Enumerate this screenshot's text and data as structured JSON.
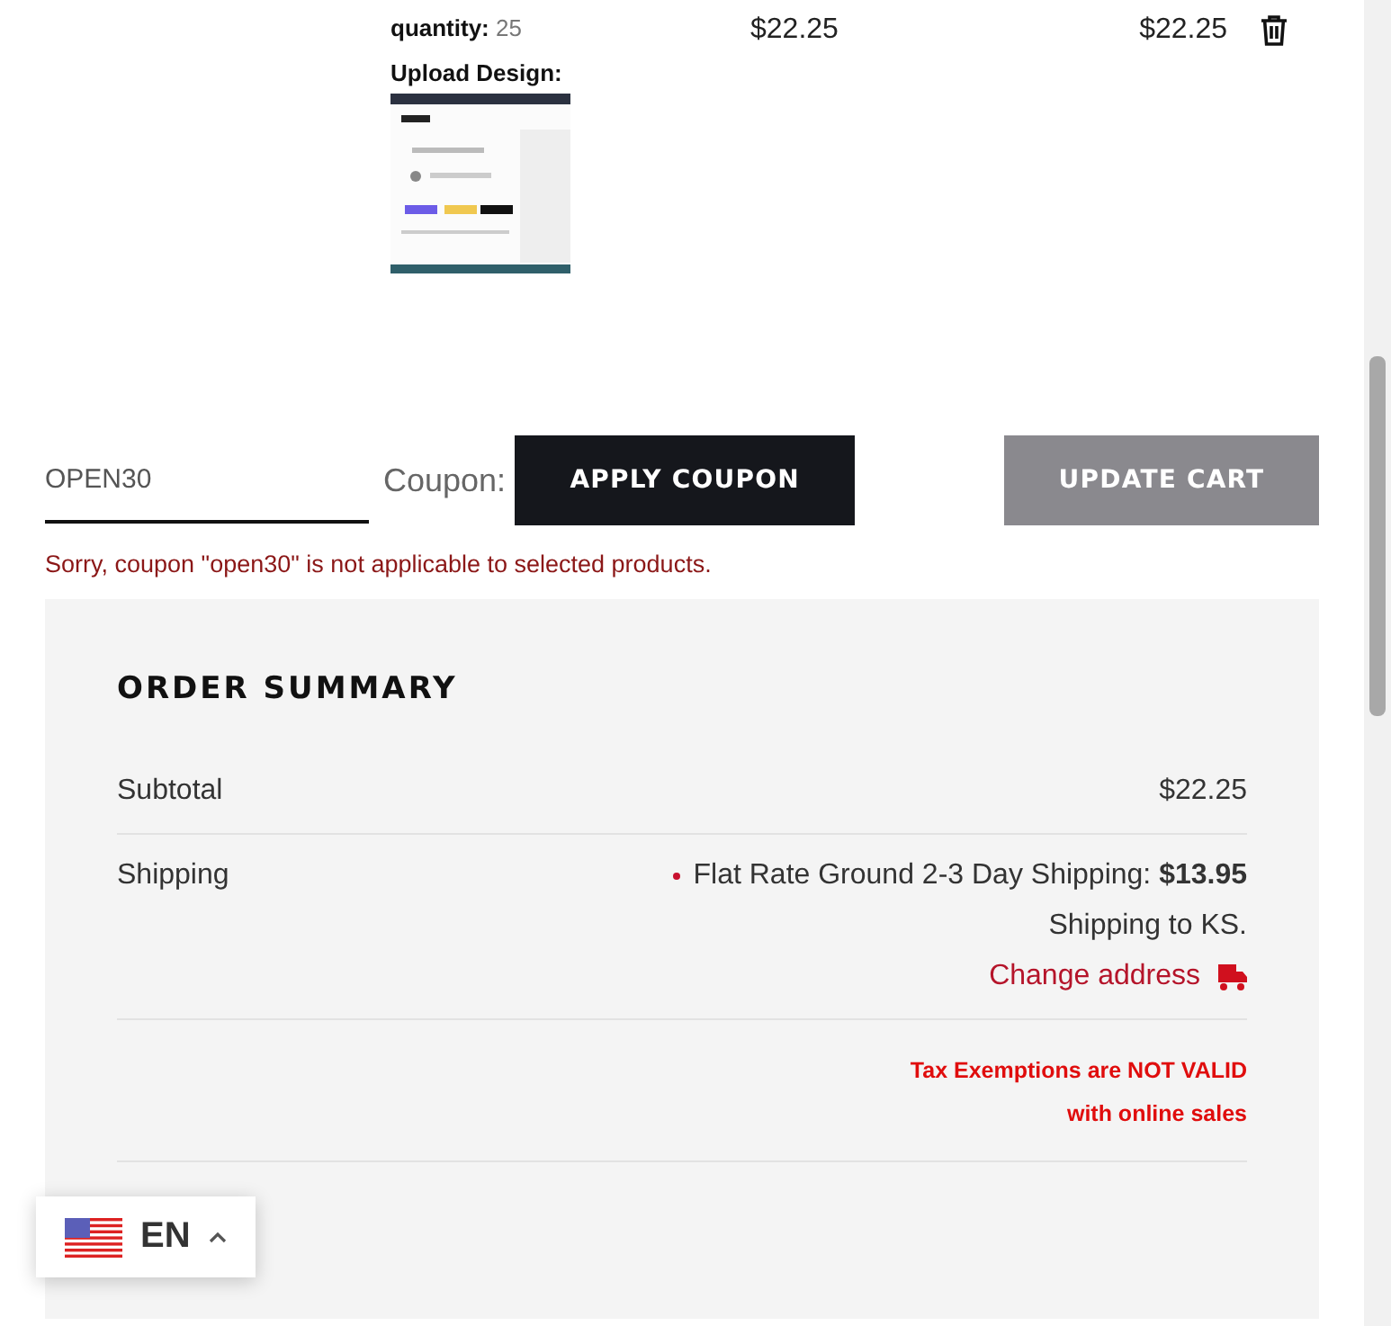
{
  "cart_item": {
    "quantity_label": "quantity:",
    "quantity": "25",
    "upload_label": "Upload Design:",
    "price": "$22.25",
    "total": "$22.25"
  },
  "coupon": {
    "value": "OPEN30",
    "label": "Coupon:",
    "apply_button": "APPLY COUPON",
    "error": "Sorry, coupon \"open30\" is not applicable to selected products."
  },
  "update_button": "UPDATE CART",
  "order_summary": {
    "title": "ORDER SUMMARY",
    "rows": [
      {
        "kind": "amount",
        "label": "Subtotal",
        "value": "$22.25"
      },
      {
        "kind": "shipping",
        "label": "Shipping",
        "method": "Flat Rate Ground 2-3 Day Shipping: **$13.95**",
        "destination": "Shipping to KS.",
        "change_link": "Change address"
      },
      {
        "kind": "notice",
        "lines": [
          "Tax Exemptions are NOT VALID",
          "with online sales"
        ]
      }
    ]
  },
  "language": {
    "code": "EN"
  }
}
